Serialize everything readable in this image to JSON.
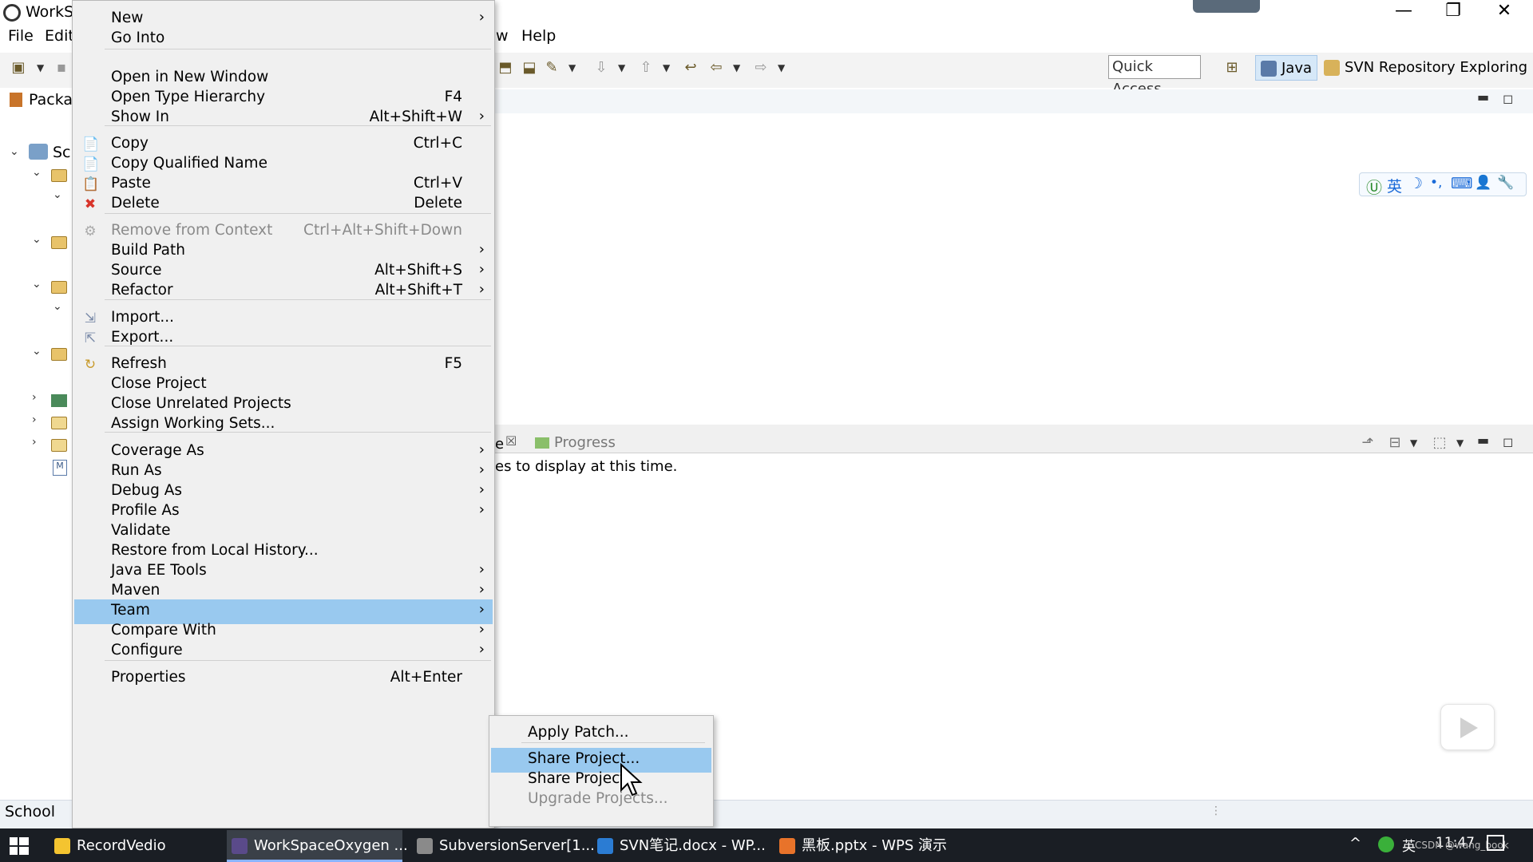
{
  "window": {
    "title": "WorkS",
    "controls": [
      "—",
      "❐",
      "✕"
    ]
  },
  "menubar": {
    "file": "File",
    "edit": "Edit",
    "window_fragment": "w",
    "help": "Help"
  },
  "toolbar": {
    "quick_access": "Quick Access",
    "perspective_java": "Java",
    "perspective_svn": "SVN Repository Exploring"
  },
  "package_explorer": {
    "title": "Packag",
    "root_label": "Sc"
  },
  "views": {
    "progress_tab": "Progress",
    "empty_message": "es to display at this time."
  },
  "status_bar": {
    "selection": "School"
  },
  "ime_bar": {
    "items": [
      "Ⓤ",
      "英",
      "☽",
      "•,",
      "⌨",
      "👤",
      "🔧"
    ]
  },
  "context_menu": {
    "items": [
      {
        "label": "New",
        "shortcut": "",
        "submenu": true
      },
      {
        "label": "Go Into",
        "shortcut": "",
        "submenu": false
      },
      {
        "label": "Open in New Window",
        "shortcut": "",
        "submenu": false
      },
      {
        "label": "Open Type Hierarchy",
        "shortcut": "F4",
        "submenu": false
      },
      {
        "label": "Show In",
        "shortcut": "Alt+Shift+W",
        "submenu": true
      },
      {
        "label": "Copy",
        "shortcut": "Ctrl+C",
        "submenu": false
      },
      {
        "label": "Copy Qualified Name",
        "shortcut": "",
        "submenu": false
      },
      {
        "label": "Paste",
        "shortcut": "Ctrl+V",
        "submenu": false
      },
      {
        "label": "Delete",
        "shortcut": "Delete",
        "submenu": false
      },
      {
        "label": "Remove from Context",
        "shortcut": "Ctrl+Alt+Shift+Down",
        "submenu": false,
        "disabled": true
      },
      {
        "label": "Build Path",
        "shortcut": "",
        "submenu": true
      },
      {
        "label": "Source",
        "shortcut": "Alt+Shift+S",
        "submenu": true
      },
      {
        "label": "Refactor",
        "shortcut": "Alt+Shift+T",
        "submenu": true
      },
      {
        "label": "Import...",
        "shortcut": "",
        "submenu": false
      },
      {
        "label": "Export...",
        "shortcut": "",
        "submenu": false
      },
      {
        "label": "Refresh",
        "shortcut": "F5",
        "submenu": false
      },
      {
        "label": "Close Project",
        "shortcut": "",
        "submenu": false
      },
      {
        "label": "Close Unrelated Projects",
        "shortcut": "",
        "submenu": false
      },
      {
        "label": "Assign Working Sets...",
        "shortcut": "",
        "submenu": false
      },
      {
        "label": "Coverage As",
        "shortcut": "",
        "submenu": true
      },
      {
        "label": "Run As",
        "shortcut": "",
        "submenu": true
      },
      {
        "label": "Debug As",
        "shortcut": "",
        "submenu": true
      },
      {
        "label": "Profile As",
        "shortcut": "",
        "submenu": true
      },
      {
        "label": "Validate",
        "shortcut": "",
        "submenu": false
      },
      {
        "label": "Restore from Local History...",
        "shortcut": "",
        "submenu": false
      },
      {
        "label": "Java EE Tools",
        "shortcut": "",
        "submenu": true
      },
      {
        "label": "Maven",
        "shortcut": "",
        "submenu": true
      },
      {
        "label": "Team",
        "shortcut": "",
        "submenu": true,
        "highlighted": true
      },
      {
        "label": "Compare With",
        "shortcut": "",
        "submenu": true
      },
      {
        "label": "Configure",
        "shortcut": "",
        "submenu": true
      },
      {
        "label": "Properties",
        "shortcut": "Alt+Enter",
        "submenu": false
      }
    ]
  },
  "team_submenu": {
    "items": [
      {
        "label": "Apply Patch..."
      },
      {
        "label": "Share Project...",
        "highlighted": true
      },
      {
        "label": "Share Projects"
      },
      {
        "label": "Upgrade Projects...",
        "disabled": true
      }
    ]
  },
  "taskbar": {
    "tasks": [
      {
        "label": "RecordVedio",
        "icon_color": "#f4c430"
      },
      {
        "label": "WorkSpaceOxygen ...",
        "icon_color": "#5a4a8a",
        "active": true
      },
      {
        "label": "SubversionServer[1...",
        "icon_color": "#8a8a8a"
      },
      {
        "label": "SVN笔记.docx - WP...",
        "icon_color": "#2b7cd3"
      },
      {
        "label": "黑板.pptx - WPS 演示",
        "icon_color": "#e8732a"
      }
    ],
    "tray_ime": "英",
    "clock": "11:47",
    "watermark": "CSDN @wang_book"
  },
  "colors": {
    "highlight": "#99c9ef",
    "menu_bg": "#f0f0f0",
    "taskbar_bg": "#1a1e24"
  }
}
